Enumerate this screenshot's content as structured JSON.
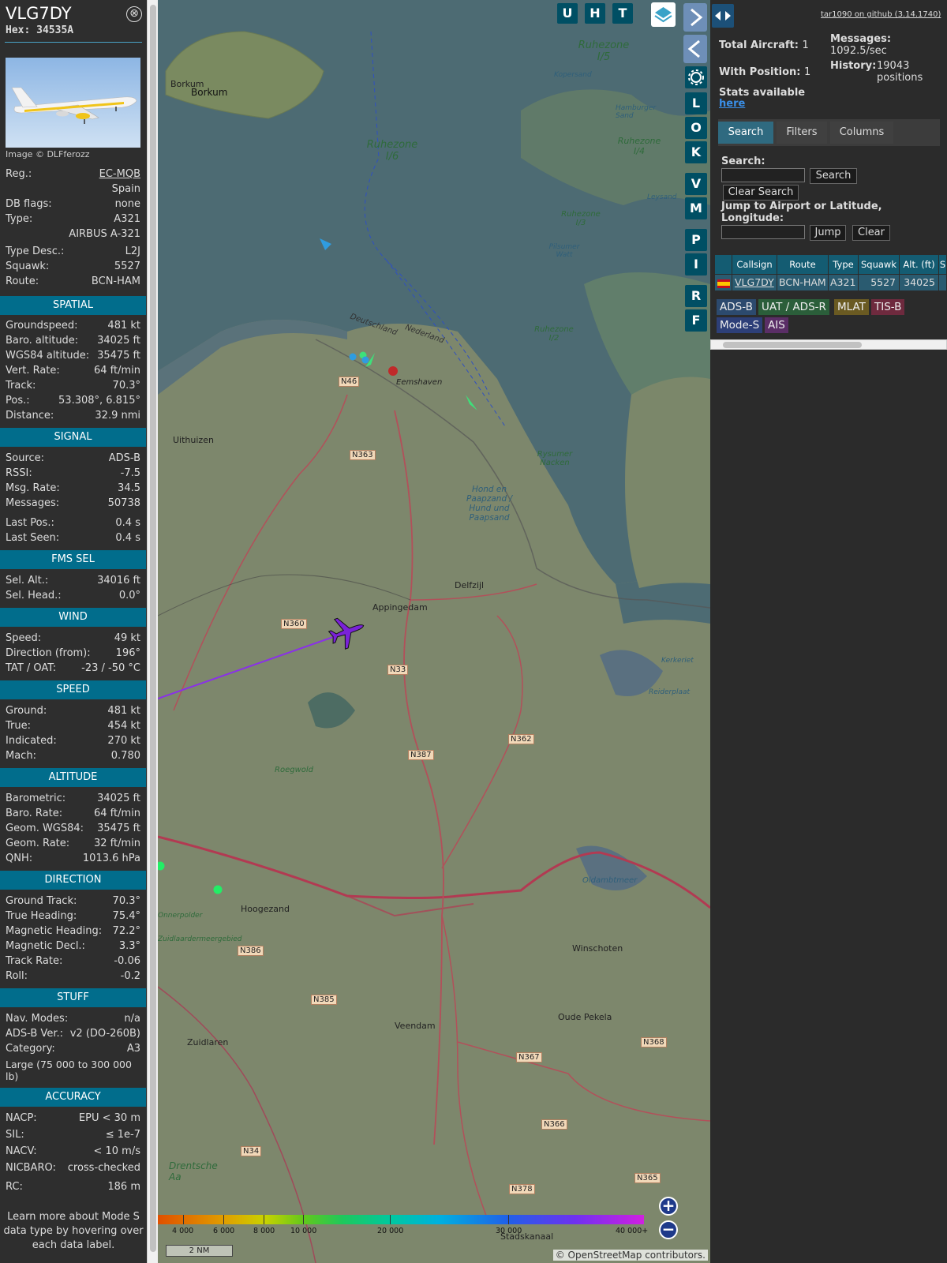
{
  "aircraft": {
    "callsign": "VLG7DY",
    "hex_label": "Hex:",
    "hex": "34535A",
    "close_glyph": "⊗",
    "photo_credit": "Image © DLFferozz"
  },
  "details": [
    {
      "label": "Reg.:",
      "value": "EC-MQB"
    },
    {
      "label": "",
      "value": "Spain"
    },
    {
      "label": "DB flags:",
      "value": "none"
    },
    {
      "label": "Type:",
      "value": "A321"
    },
    {
      "label": "",
      "value": "AIRBUS A-321"
    },
    {
      "label": "Type Desc.:",
      "value": "L2J"
    },
    {
      "label": "Squawk:",
      "value": "5527"
    },
    {
      "label": "Route:",
      "value": "BCN-HAM"
    }
  ],
  "sections": {
    "spatial": {
      "title": "SPATIAL",
      "rows": [
        {
          "label": "Groundspeed:",
          "value": "481 kt"
        },
        {
          "label": "Baro. altitude:",
          "value": "34025 ft"
        },
        {
          "label": "WGS84 altitude:",
          "value": "35475 ft"
        },
        {
          "label": "Vert. Rate:",
          "value": "64 ft/min"
        },
        {
          "label": "Track:",
          "value": "70.3°"
        },
        {
          "label": "Pos.:",
          "value": "53.308°, 6.815°"
        },
        {
          "label": "Distance:",
          "value": "32.9 nmi"
        }
      ]
    },
    "signal": {
      "title": "SIGNAL",
      "rows": [
        {
          "label": "Source:",
          "value": "ADS-B"
        },
        {
          "label": "RSSI:",
          "value": "-7.5"
        },
        {
          "label": "Msg. Rate:",
          "value": "34.5"
        },
        {
          "label": "Messages:",
          "value": "50738"
        },
        {
          "label": "Last Pos.:",
          "value": "0.4 s"
        },
        {
          "label": "Last Seen:",
          "value": "0.4 s"
        }
      ]
    },
    "fms": {
      "title": "FMS SEL",
      "rows": [
        {
          "label": "Sel. Alt.:",
          "value": "34016 ft"
        },
        {
          "label": "Sel. Head.:",
          "value": "0.0°"
        }
      ]
    },
    "wind": {
      "title": "WIND",
      "rows": [
        {
          "label": "Speed:",
          "value": "49 kt"
        },
        {
          "label": "Direction (from):",
          "value": "196°"
        },
        {
          "label": "TAT / OAT:",
          "value": "-23 / -50 °C"
        }
      ]
    },
    "speed": {
      "title": "SPEED",
      "rows": [
        {
          "label": "Ground:",
          "value": "481 kt"
        },
        {
          "label": "True:",
          "value": "454 kt"
        },
        {
          "label": "Indicated:",
          "value": "270 kt"
        },
        {
          "label": "Mach:",
          "value": "0.780"
        }
      ]
    },
    "altitude": {
      "title": "ALTITUDE",
      "rows": [
        {
          "label": "Barometric:",
          "value": "34025 ft"
        },
        {
          "label": "Baro. Rate:",
          "value": "64 ft/min"
        },
        {
          "label": "Geom. WGS84:",
          "value": "35475 ft"
        },
        {
          "label": "Geom. Rate:",
          "value": "32 ft/min"
        },
        {
          "label": "QNH:",
          "value": "1013.6 hPa"
        }
      ]
    },
    "direction": {
      "title": "DIRECTION",
      "rows": [
        {
          "label": "Ground Track:",
          "value": "70.3°"
        },
        {
          "label": "True Heading:",
          "value": "75.4°"
        },
        {
          "label": "Magnetic Heading:",
          "value": "72.2°"
        },
        {
          "label": "Magnetic Decl.:",
          "value": "3.3°"
        },
        {
          "label": "Track Rate:",
          "value": "-0.06"
        },
        {
          "label": "Roll:",
          "value": "-0.2"
        }
      ]
    },
    "stuff": {
      "title": "STUFF",
      "rows": [
        {
          "label": "Nav. Modes:",
          "value": "n/a"
        },
        {
          "label": "ADS-B Ver.:",
          "value": "v2 (DO-260B)"
        },
        {
          "label": "Category:",
          "value": "A3"
        }
      ],
      "category_desc": "Large (75 000 to 300 000 lb)"
    },
    "accuracy": {
      "title": "ACCURACY",
      "rows": [
        {
          "label": "NACP:",
          "value": "EPU < 30 m"
        },
        {
          "label": "SIL:",
          "value": "≤ 1e-7"
        },
        {
          "label": "NACV:",
          "value": "< 10 m/s"
        },
        {
          "label": "NICBARO:",
          "value": "cross-checked"
        },
        {
          "label": "RC:",
          "value": "186 m"
        }
      ]
    }
  },
  "footnote": "Learn more about Mode S data type by hovering over each data label.",
  "map": {
    "buttons_row": [
      "U",
      "H",
      "T"
    ],
    "buttons_col": [
      "L",
      "O",
      "K",
      "V",
      "M",
      "P",
      "I",
      "R",
      "F"
    ],
    "zoom_in": "+",
    "zoom_out": "−",
    "scale": "2 NM",
    "attribution": "© OpenStreetMap contributors.",
    "altitude_key": [
      "4 000",
      "6 000",
      "8 000",
      "10 000",
      "20 000",
      "30 000",
      "40 000+"
    ],
    "places": [
      {
        "name": "Borkum"
      },
      {
        "name": "Borkum"
      },
      {
        "name": "Ruhezone I/5"
      },
      {
        "name": "Ruhezone I/6"
      },
      {
        "name": "Ruhezone I/4"
      },
      {
        "name": "Ruhezone I/3"
      },
      {
        "name": "Ruhezone I/2"
      },
      {
        "name": "Eemshaven"
      },
      {
        "name": "Uithuizen"
      },
      {
        "name": "Delfzijl"
      },
      {
        "name": "Appingedam"
      },
      {
        "name": "Hoogezand"
      },
      {
        "name": "Winschoten"
      },
      {
        "name": "Veendam"
      },
      {
        "name": "Oude Pekela"
      },
      {
        "name": "Zuidlaren"
      },
      {
        "name": "Stadskanaal"
      },
      {
        "name": "Drentsche Aa"
      },
      {
        "name": "Hond en Paapzand / Hund und Paapsand"
      },
      {
        "name": "Deutschland"
      },
      {
        "name": "Nederland"
      },
      {
        "name": "Rysumer Nacken"
      },
      {
        "name": "Oldambtmeer"
      },
      {
        "name": "Roegwold"
      },
      {
        "name": "Kopersand"
      },
      {
        "name": "Hamburger Sand"
      },
      {
        "name": "Pilsumer Watt"
      },
      {
        "name": "Leysand"
      },
      {
        "name": "Kerkeriet"
      },
      {
        "name": "Reiderplaat"
      },
      {
        "name": "Zuidlaardermeergebied"
      },
      {
        "name": "Onnerpolder"
      }
    ],
    "roads": [
      "N46",
      "N363",
      "N360",
      "N33",
      "N387",
      "N362",
      "N386",
      "N385",
      "N367",
      "N366",
      "N368",
      "N34",
      "N378",
      "N365"
    ]
  },
  "sidebar": {
    "version_link": "tar1090 on github (3.14.1740)",
    "total_aircraft_label": "Total Aircraft:",
    "total_aircraft": "1",
    "with_position_label": "With Position:",
    "with_position": "1",
    "messages_label": "Messages:",
    "messages": "1092.5/sec",
    "history_label": "History:",
    "history": "19043 positions",
    "stats_label": "Stats available",
    "stats_link": "here",
    "tabs": [
      "Search",
      "Filters",
      "Columns"
    ],
    "search_label": "Search:",
    "search_button": "Search",
    "clear_search_button": "Clear Search",
    "jump_label": "Jump to Airport or Latitude, Longitude:",
    "jump_button": "Jump",
    "clear_button": "Clear",
    "table_headers": [
      "",
      "Callsign",
      "Route",
      "Type",
      "Squawk",
      "Alt. (ft)",
      "S"
    ],
    "table_row": {
      "callsign": "VLG7DY",
      "route": "BCN-HAM",
      "type": "A321",
      "squawk": "5527",
      "alt": "34025"
    },
    "source_badges": [
      {
        "label": "ADS-B",
        "color": "#2c4a6e"
      },
      {
        "label": "UAT / ADS-R",
        "color": "#2b5e3a"
      },
      {
        "label": "MLAT",
        "color": "#6a5a22"
      },
      {
        "label": "TIS-B",
        "color": "#6e2a3e"
      },
      {
        "label": "Mode-S",
        "color": "#2d3f78"
      },
      {
        "label": "AIS",
        "color": "#5a2e66"
      }
    ]
  },
  "colors": {
    "section_bg": "#016d8c",
    "aircraft_icon": "#7a22d8",
    "track_line": "#8a30e8"
  }
}
